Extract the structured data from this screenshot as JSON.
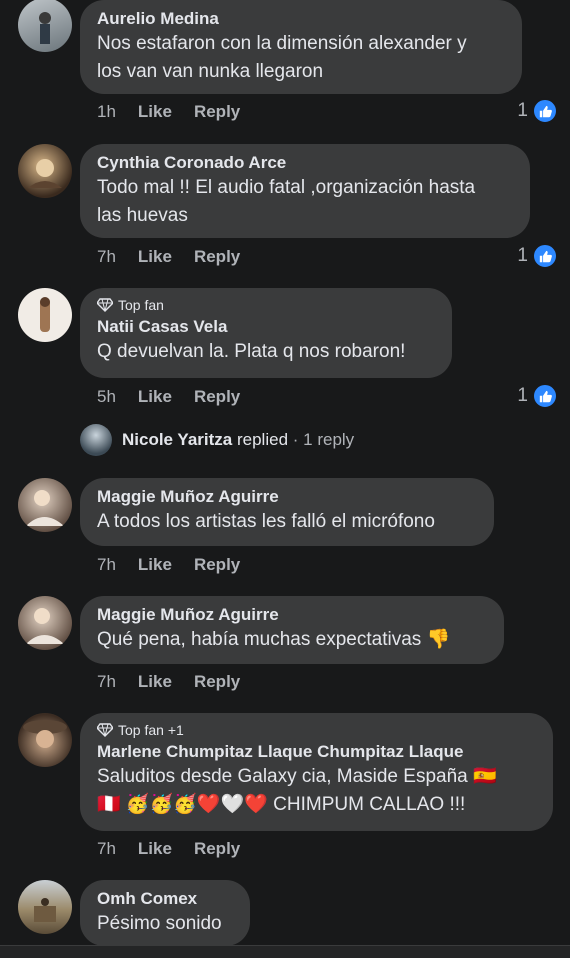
{
  "comments": [
    {
      "name": "Aurelio Medina",
      "badge": "",
      "lines": [
        "Nos estafaron con la dimensión alexander y",
        "los van van nunka llegaron"
      ],
      "time": "1h",
      "like_label": "Like",
      "reply_label": "Reply",
      "likes": "1",
      "avatar_colors": [
        "#8a9aa6",
        "#4f5a60"
      ]
    },
    {
      "name": "Cynthia Coronado Arce",
      "badge": "",
      "lines": [
        "Todo mal !! El audio fatal ,organización hasta",
        "las huevas"
      ],
      "time": "7h",
      "like_label": "Like",
      "reply_label": "Reply",
      "likes": "1",
      "avatar_colors": [
        "#c2a073",
        "#3b2a1e"
      ]
    },
    {
      "name": "Natii Casas Vela",
      "badge": "Top fan",
      "lines": [
        "Q devuelvan la. Plata q nos robaron!"
      ],
      "time": "5h",
      "like_label": "Like",
      "reply_label": "Reply",
      "likes": "1",
      "avatar_colors": [
        "#f2ede8",
        "#a07a5a"
      ]
    },
    {
      "name": "Maggie Muñoz Aguirre",
      "badge": "",
      "lines": [
        "A todos los artistas les falló el micrófono"
      ],
      "time": "7h",
      "like_label": "Like",
      "reply_label": "Reply",
      "likes": "",
      "avatar_colors": [
        "#c9b7a7",
        "#6b564a"
      ]
    },
    {
      "name": "Maggie Muñoz Aguirre",
      "badge": "",
      "lines": [
        "Qué pena, había muchas expectativas 👎"
      ],
      "time": "7h",
      "like_label": "Like",
      "reply_label": "Reply",
      "likes": "",
      "avatar_colors": [
        "#c9b7a7",
        "#6b564a"
      ]
    },
    {
      "name": "Marlene Chumpitaz Llaque Chumpitaz Llaque",
      "badge": "Top fan +1",
      "lines": [
        "Saluditos desde Galaxy cia, Maside España 🇪🇸",
        "🇵🇪 🥳🥳🥳❤️🤍❤️ CHIMPUM CALLAO !!!"
      ],
      "time": "7h",
      "like_label": "Like",
      "reply_label": "Reply",
      "likes": "",
      "avatar_colors": [
        "#b99477",
        "#3e2c22"
      ]
    },
    {
      "name": "Omh Comex",
      "badge": "",
      "lines": [
        "Pésimo sonido"
      ],
      "time": "",
      "like_label": "",
      "reply_label": "",
      "likes": "",
      "avatar_colors": [
        "#9a8a6a",
        "#4b4030"
      ]
    }
  ],
  "reply_summary": {
    "name": "Nicole Yaritza",
    "text": "replied",
    "count": "· 1 reply"
  },
  "colors": {
    "bubble": "#3a3b3c",
    "background": "#18191a",
    "like_blue": "#2d88ff"
  }
}
